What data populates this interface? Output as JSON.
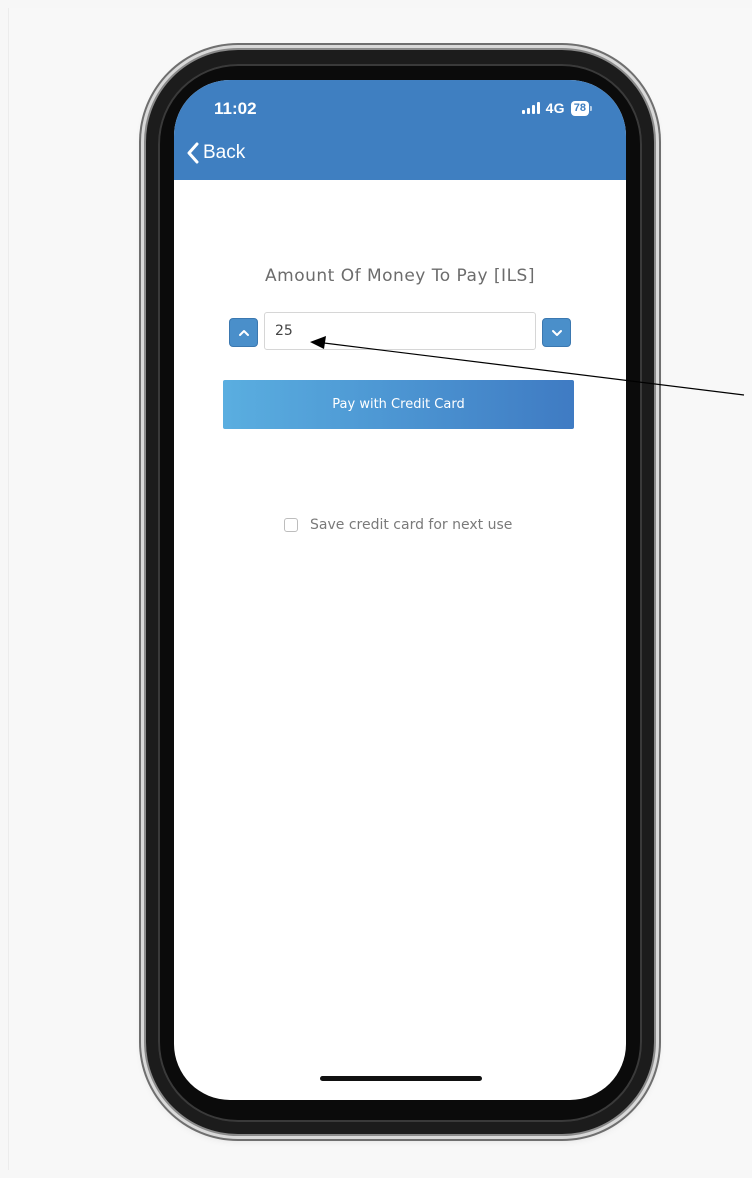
{
  "status_bar": {
    "time": "11:02",
    "network": "4G",
    "battery": "78",
    "icons": [
      "signal-icon",
      "battery-icon"
    ]
  },
  "header": {
    "back_label": "Back",
    "back_icon": "chevron-left-icon"
  },
  "payment": {
    "title": "Amount Of Money To Pay [ILS]",
    "amount_value": "25",
    "increment_icon": "chevron-up-icon",
    "decrement_icon": "chevron-down-icon",
    "pay_button_label": "Pay with Credit Card",
    "save_card_label": "Save credit card for next use",
    "save_card_checked": false
  },
  "colors": {
    "header_blue": "#3f7fc1",
    "button_gradient_start": "#5aaee0",
    "button_gradient_end": "#3f7bc3",
    "stepper_blue": "#4a8fca"
  }
}
